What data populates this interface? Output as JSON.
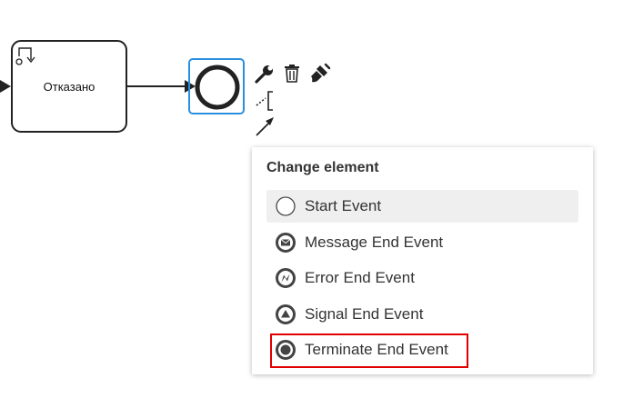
{
  "diagram": {
    "task": {
      "label": "Отказано"
    }
  },
  "context_pad": {
    "buttons": [
      {
        "name": "wrench-icon"
      },
      {
        "name": "trash-icon"
      },
      {
        "name": "paint-brush-icon"
      },
      {
        "name": "text-annotation-icon"
      },
      {
        "name": "connect-arrow-icon"
      }
    ]
  },
  "popup": {
    "title": "Change element",
    "items": [
      {
        "label": "Start Event",
        "icon": "start-event-icon",
        "active": true
      },
      {
        "label": "Message End Event",
        "icon": "message-end-event-icon"
      },
      {
        "label": "Error End Event",
        "icon": "error-end-event-icon"
      },
      {
        "label": "Signal End Event",
        "icon": "signal-end-event-icon"
      },
      {
        "label": "Terminate End Event",
        "icon": "terminate-end-event-icon",
        "highlighted": true
      }
    ]
  },
  "colors": {
    "selection": "#2a8fe0",
    "highlight": "#e00000",
    "stroke": "#222222",
    "active_item_bg": "#efefef"
  }
}
